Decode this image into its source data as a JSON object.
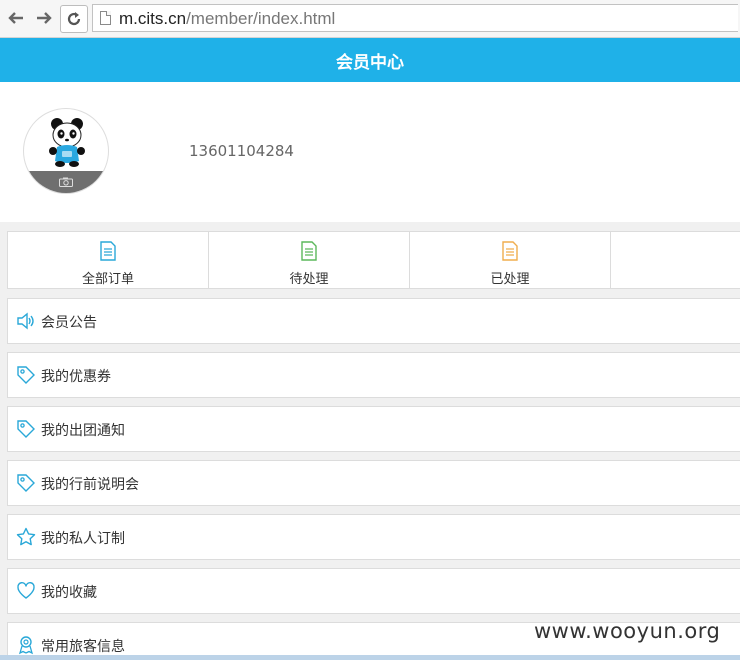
{
  "browser": {
    "url_host": "m.cits.cn",
    "url_path": "/member/index.html"
  },
  "header": {
    "title": "会员中心"
  },
  "profile": {
    "phone": "13601104284",
    "avatar_icon": "panda-avatar",
    "camera_icon": "camera-icon"
  },
  "order_tabs": [
    {
      "label": "全部订单",
      "icon": "document-icon",
      "color": "#2aa8d8"
    },
    {
      "label": "待处理",
      "icon": "document-icon",
      "color": "#5cb85c"
    },
    {
      "label": "已处理",
      "icon": "document-icon",
      "color": "#f0ad4e"
    },
    {
      "label": "",
      "icon": "",
      "color": ""
    }
  ],
  "menu": [
    {
      "label": "会员公告",
      "icon": "speaker-icon"
    },
    {
      "label": "我的优惠券",
      "icon": "tag-icon"
    },
    {
      "label": "我的出团通知",
      "icon": "tag-icon"
    },
    {
      "label": "我的行前说明会",
      "icon": "tag-icon"
    },
    {
      "label": "我的私人订制",
      "icon": "star-icon"
    },
    {
      "label": "我的收藏",
      "icon": "heart-icon"
    },
    {
      "label": "常用旅客信息",
      "icon": "person-badge-icon"
    }
  ],
  "watermark": "www.wooyun.org",
  "colors": {
    "accent": "#1fb1e8",
    "icon_blue": "#2aa8d8"
  }
}
